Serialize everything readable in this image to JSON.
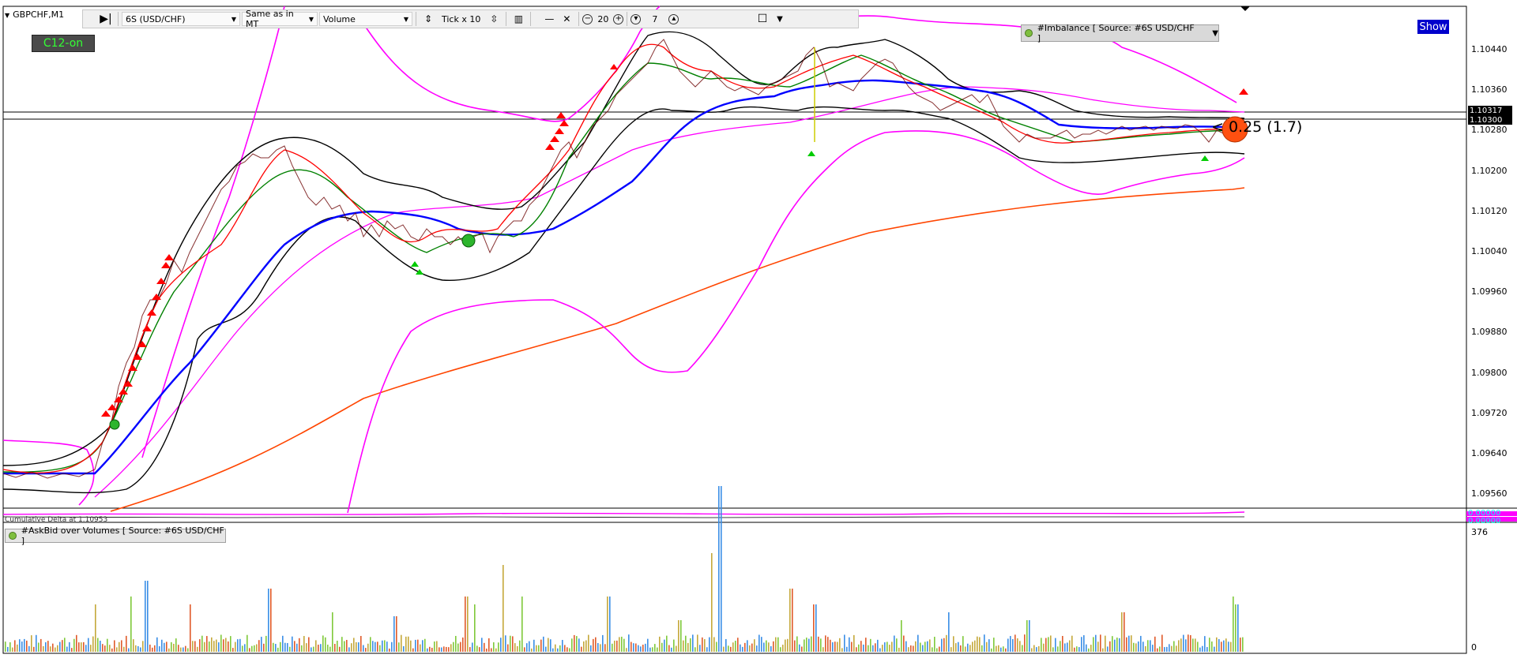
{
  "chart": {
    "symbol_title": "GBPCHF,M1",
    "c12_label": "C12-on",
    "show_label": "Show",
    "overlay_label": "< 0.25 (1.7)",
    "imbalance_label": "#Imbalance [ Source: #6S USD/CHF ]",
    "askbid_label": "#AskBid over Volumes [ Source: #6S USD/CHF ]",
    "subpanel_text": "Cumulative Delta at 1.10953",
    "price_axis": [
      "1.10440",
      "1.10360",
      "1.10280",
      "1.10200",
      "1.10120",
      "1.10040",
      "1.09960",
      "1.09880",
      "1.09800",
      "1.09720",
      "1.09640",
      "1.09560"
    ],
    "price_tags": {
      "bid": "1.10317",
      "ask": "1.10300"
    },
    "sub_axis": {
      "top": "0.00000",
      "bottom": "0.00000"
    },
    "volume_axis": {
      "max": "376",
      "min": "0"
    },
    "colors": {
      "accent_magenta": "#ff00ff",
      "ma_blue": "#0000ff",
      "ma_orange": "#ff4500",
      "show_blue": "#0000cc",
      "c12_green": "#34ff34"
    }
  },
  "toolbar": {
    "instrument": "6S (USD/CHF)",
    "mode": "Same as in MT",
    "type": "Volume",
    "tick_label": "Tick x 10",
    "zoom_value": "20",
    "depth_value": "7"
  }
}
